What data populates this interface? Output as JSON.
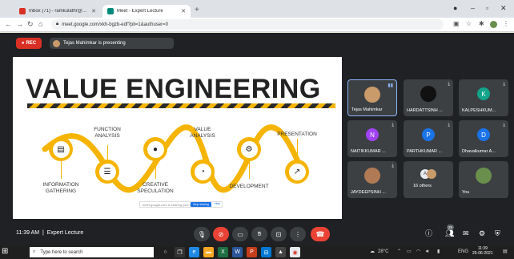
{
  "browser": {
    "tabs": [
      {
        "title": "Inbox (71) - ramkulathr@bnbtu...",
        "favicon_color": "#d93025"
      },
      {
        "title": "Meet - Expert Lecture",
        "favicon_color": "#00897b"
      }
    ],
    "new_tab": "+",
    "url": "meet.google.com/xkh-bgzb-edf?pli=1&authuser=0"
  },
  "meet": {
    "rec_label": "REC",
    "presenting_text": "Tejas Mahimkar is presenting",
    "time": "11:39 AM",
    "meeting_name": "Expert Lecture",
    "people_count": "25"
  },
  "slide": {
    "title": "VALUE ENGINEERING",
    "steps": [
      {
        "label": "INFORMATION\nGATHERING",
        "icon": "list-icon",
        "glyph": "▤"
      },
      {
        "label": "FUNCTION\nANALYSIS",
        "icon": "checklist-icon",
        "glyph": "☰"
      },
      {
        "label": "CREATIVE\nSPECULATION",
        "icon": "lightbulb-icon",
        "glyph": "●"
      },
      {
        "label": "VALUE\nANALYSIS",
        "icon": "pie-chart-icon",
        "glyph": "◔"
      },
      {
        "label": "DEVELOPMENT",
        "icon": "gears-icon",
        "glyph": "⚙"
      },
      {
        "label": "PRESENTATION",
        "icon": "growth-chart-icon",
        "glyph": "↗"
      }
    ],
    "share_notice": "meet.google.com is sharing your screen.",
    "stop_sharing": "Stop sharing",
    "hide": "Hide"
  },
  "participants": [
    {
      "name": "Tejas Mahimkar",
      "avatar_letter": "",
      "avatar_color": "#c99a6a",
      "speaking": true
    },
    {
      "name": "HARDATTSINH ...",
      "avatar_letter": "",
      "avatar_color": "#111111",
      "speaking": false
    },
    {
      "name": "KALPESHKUM...",
      "avatar_letter": "K",
      "avatar_color": "#12a38a",
      "speaking": false
    },
    {
      "name": "NAITIKKUMAR ...",
      "avatar_letter": "N",
      "avatar_color": "#a142f4",
      "speaking": false
    },
    {
      "name": "PARTHKUMAR ...",
      "avatar_letter": "P",
      "avatar_color": "#1a73e8",
      "speaking": false
    },
    {
      "name": "Dhavalkumar A...",
      "avatar_letter": "D",
      "avatar_color": "#1a73e8",
      "speaking": false
    },
    {
      "name": "JAYDEEPSINH ...",
      "avatar_letter": "",
      "avatar_color": "#b07a54",
      "speaking": false
    },
    {
      "name": "16 others",
      "avatar_letter": "A",
      "avatar_color": "#e8eaed",
      "speaking": false
    },
    {
      "name": "You",
      "avatar_letter": "",
      "avatar_color": "#6a8f4d",
      "speaking": false
    }
  ],
  "taskbar": {
    "search_placeholder": "Type here to search",
    "temperature": "28°C",
    "language": "ENG",
    "clock_time": "11:39",
    "clock_date": "25-06-2021"
  }
}
